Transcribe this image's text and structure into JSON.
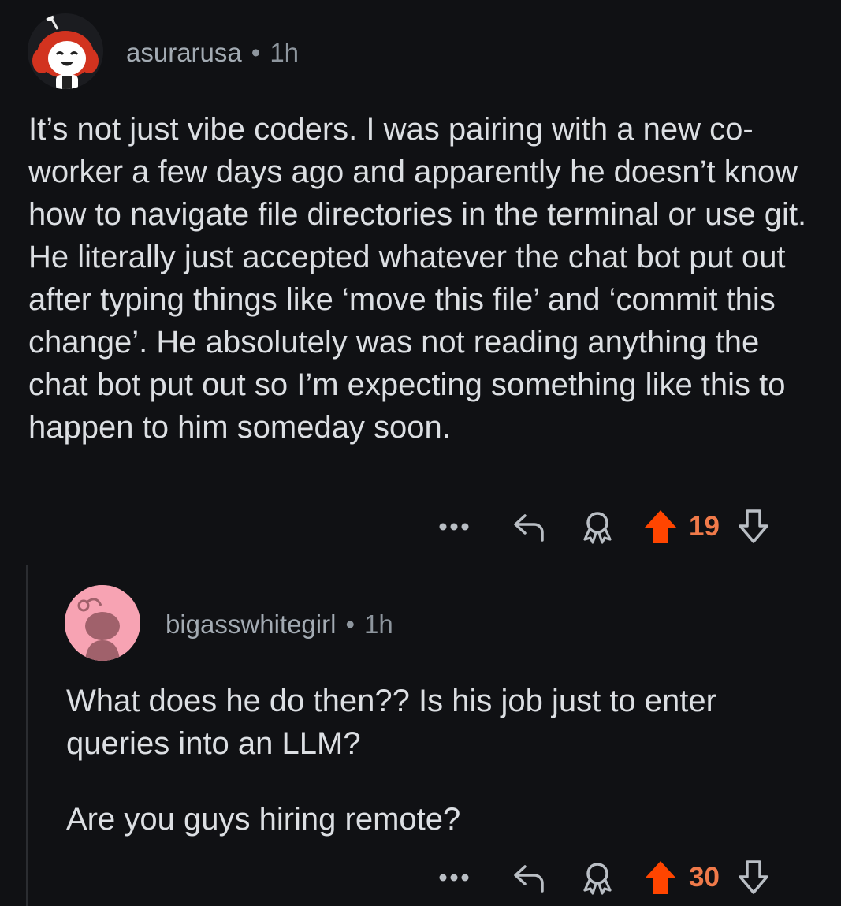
{
  "comments": [
    {
      "author": "asurarusa",
      "separator": "•",
      "age": "1h",
      "avatar": "reddit-snoo-avatar-red-hair",
      "body": [
        "It’s not just vibe coders. I was pairing with a new co-worker a few days ago and apparently he doesn’t know how to navigate file directories in the terminal or use git. He literally just accepted whatever the chat bot put out after typing things like ‘move this file’ and ‘commit this change’. He absolutely was not reading anything the chat bot put out so I’m expecting something like this to happen to him someday soon."
      ],
      "score": "19",
      "upvoted": true
    },
    {
      "author": "bigasswhitegirl",
      "separator": "•",
      "age": "1h",
      "avatar": "reddit-default-snoo-avatar-pink",
      "body": [
        "What does he do then?? Is his job just to enter queries into an LLM?",
        "Are you guys hiring remote?"
      ],
      "score": "30",
      "upvoted": true
    }
  ],
  "icons": {
    "more": "more-options-icon",
    "reply": "reply-icon",
    "award": "award-icon",
    "upvote": "upvote-arrow-icon",
    "downvote": "downvote-arrow-icon"
  },
  "colors": {
    "background": "#101114",
    "upvote_active": "#ff4500",
    "score_active": "#f07a4a",
    "meta_text": "#8e969e",
    "body_text": "#dcdfe3"
  }
}
